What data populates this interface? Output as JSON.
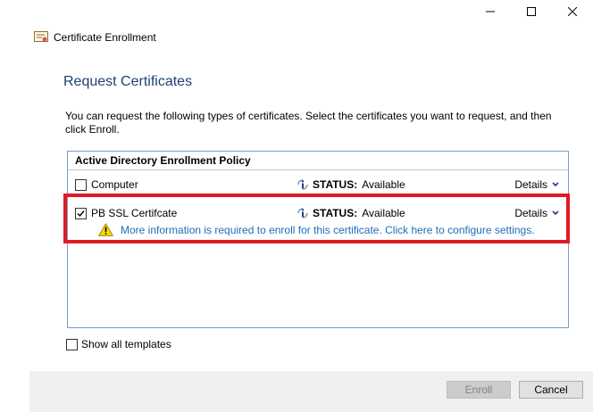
{
  "window": {
    "title": "Certificate Enrollment",
    "controls": [
      "minimize-icon",
      "maximize-icon",
      "close-icon"
    ]
  },
  "page": {
    "heading": "Request Certificates",
    "intro": "You can request the following types of certificates. Select the certificates you want to request, and then click Enroll."
  },
  "policy": {
    "title": "Active Directory Enrollment Policy",
    "certificates": [
      {
        "name": "Computer",
        "checked": false,
        "status_label": "STATUS:",
        "status_value": "Available",
        "details_label": "Details"
      },
      {
        "name": "PB SSL Certifcate",
        "checked": true,
        "status_label": "STATUS:",
        "status_value": "Available",
        "details_label": "Details"
      }
    ],
    "warning": "More information is required to enroll for this certificate. Click here to configure settings."
  },
  "show_all_templates": {
    "label": "Show all templates",
    "checked": false
  },
  "buttons": {
    "enroll": "Enroll",
    "cancel": "Cancel"
  },
  "colors": {
    "heading": "#1e3f78",
    "link": "#1a6fb5",
    "highlight": "#e01b24",
    "border": "#7a9cc6"
  }
}
